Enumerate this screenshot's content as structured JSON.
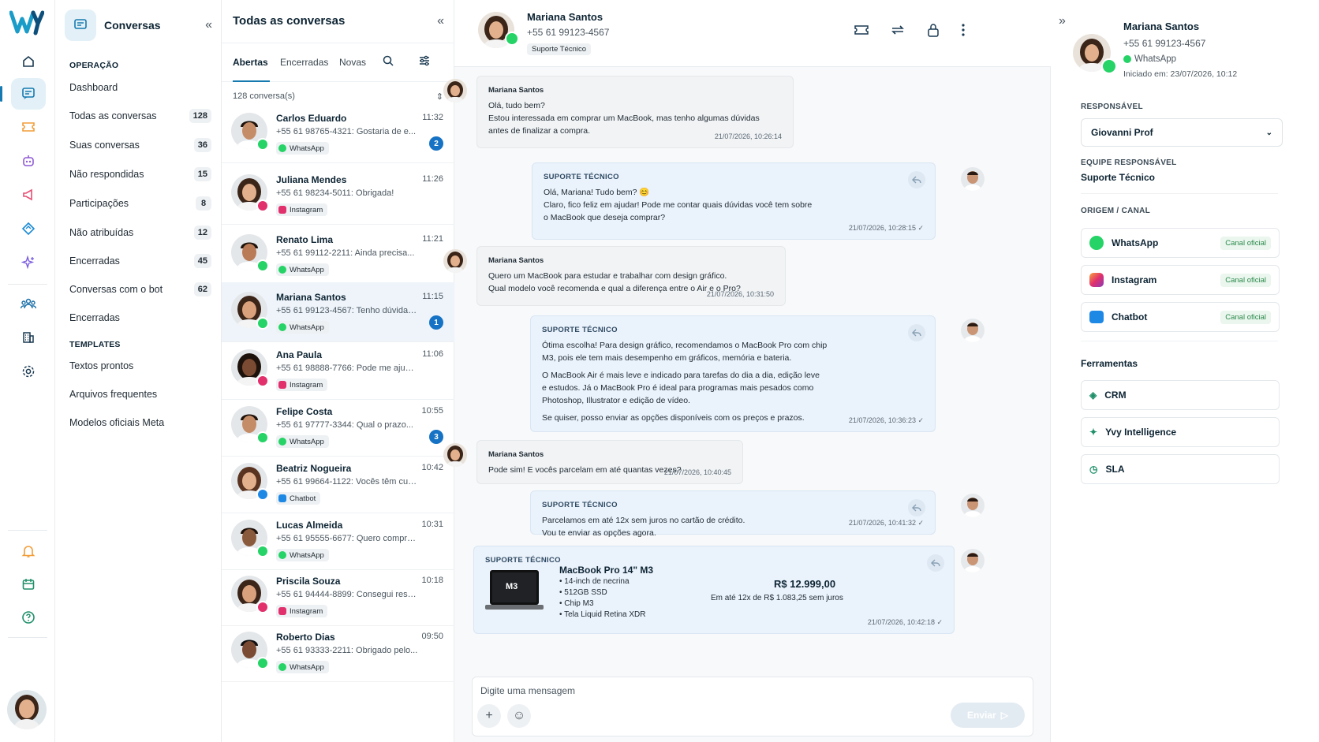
{
  "brand": {
    "logo": "Wy"
  },
  "rail": {
    "items": [
      "home-icon",
      "chat-icon",
      "ticket-icon",
      "bot-icon",
      "megaphone-icon",
      "tag-icon",
      "sparkle-icon",
      "team-icon",
      "building-icon",
      "settings-icon"
    ],
    "bottom": [
      "bell-icon",
      "calendar-icon",
      "help-icon"
    ]
  },
  "nav": {
    "title": "Conversas",
    "section_operacao": "OPERAÇÃO",
    "items": [
      {
        "label": "Dashboard",
        "count": ""
      },
      {
        "label": "Todas as conversas",
        "count": "128"
      },
      {
        "label": "Suas conversas",
        "count": "36"
      },
      {
        "label": "Não respondidas",
        "count": "15"
      },
      {
        "label": "Participações",
        "count": "8"
      },
      {
        "label": "Não atribuídas",
        "count": "12"
      },
      {
        "label": "Encerradas",
        "count": "45"
      },
      {
        "label": "Conversas com o bot",
        "count": "62"
      },
      {
        "label": "Encerradas",
        "count": ""
      }
    ],
    "section_templates": "TEMPLATES",
    "templates": [
      "Textos prontos",
      "Arquivos frequentes",
      "Modelos oficiais Meta"
    ]
  },
  "list": {
    "title": "Todas as conversas",
    "tabs": [
      "Abertas",
      "Encerradas",
      "Novas"
    ],
    "count": "128 conversa(s)",
    "conversations": [
      {
        "name": "Carlos Eduardo",
        "time": "11:32",
        "preview": "+55 61 98765-4321: Gostaria de e...",
        "channel": "WhatsApp",
        "badge": "2"
      },
      {
        "name": "Juliana Mendes",
        "time": "11:26",
        "preview": "+55 61 98234-5011: Obrigada!",
        "channel": "Instagram",
        "badge": ""
      },
      {
        "name": "Renato Lima",
        "time": "11:21",
        "preview": "+55 61 99112-2211: Ainda precisa...",
        "channel": "WhatsApp",
        "badge": ""
      },
      {
        "name": "Mariana Santos",
        "time": "11:15",
        "preview": "+55 61 99123-4567: Tenho dúvidas...",
        "channel": "WhatsApp",
        "badge": "1"
      },
      {
        "name": "Ana Paula",
        "time": "11:06",
        "preview": "+55 61 98888-7766: Pode me ajudar...",
        "channel": "Instagram",
        "badge": ""
      },
      {
        "name": "Felipe Costa",
        "time": "10:55",
        "preview": "+55 61 97777-3344: Qual o prazo...",
        "channel": "WhatsApp",
        "badge": "3"
      },
      {
        "name": "Beatriz Nogueira",
        "time": "10:42",
        "preview": "+55 61 99664-1122: Vocês têm cupom...",
        "channel": "Chatbot",
        "badge": ""
      },
      {
        "name": "Lucas Almeida",
        "time": "10:31",
        "preview": "+55 61 95555-6677: Quero compra...",
        "channel": "WhatsApp",
        "badge": ""
      },
      {
        "name": "Priscila Souza",
        "time": "10:18",
        "preview": "+55 61 94444-8899: Consegui resolver",
        "channel": "Instagram",
        "badge": ""
      },
      {
        "name": "Roberto Dias",
        "time": "09:50",
        "preview": "+55 61 93333-2211: Obrigado pelo...",
        "channel": "WhatsApp",
        "badge": ""
      }
    ]
  },
  "chat": {
    "name": "Mariana Santos",
    "phone": "+55 61 99123-4567",
    "tag": "Suporte Técnico",
    "messages": [
      {
        "from": "Mariana Santos",
        "lines": [
          "Olá, tudo bem?",
          "Estou interessada em comprar um MacBook, mas tenho algumas dúvidas",
          "antes de finalizar a compra."
        ],
        "ts": "21/07/2026, 10:26:14"
      },
      {
        "from": "SUPORTE TÉCNICO",
        "lines": [
          "Olá, Mariana! Tudo bem? 😊",
          "Claro, fico feliz em ajudar! Pode me contar quais dúvidas você tem sobre",
          "o MacBook que deseja comprar?"
        ],
        "ts": "21/07/2026, 10:28:15 ✓"
      },
      {
        "from": "Mariana Santos",
        "lines": [
          "Quero um MacBook para estudar e trabalhar com design gráfico.",
          "Qual modelo você recomenda e qual a diferença entre o Air e o Pro?"
        ],
        "ts": "21/07/2026, 10:31:50"
      },
      {
        "from": "SUPORTE TÉCNICO",
        "lines": [
          "Ótima escolha! Para design gráfico, recomendamos o MacBook Pro com chip",
          "M3, pois ele tem mais desempenho em gráficos, memória e bateria.",
          "",
          "O MacBook Air é mais leve e indicado para tarefas do dia a dia, edição leve",
          "e estudos. Já o MacBook Pro é ideal para programas mais pesados como",
          "Photoshop, Illustrator e edição de vídeo.",
          "",
          "Se quiser, posso enviar as opções disponíveis com os preços e prazos."
        ],
        "ts": "21/07/2026, 10:36:23 ✓"
      },
      {
        "from": "Mariana Santos",
        "lines": [
          "Pode sim! E vocês parcelam em até quantas vezes?"
        ],
        "ts": "21/07/2026, 10:40:45"
      },
      {
        "from": "SUPORTE TÉCNICO",
        "lines": [
          "Parcelamos em até 12x sem juros no cartão de crédito.",
          "Vou te enviar as opções agora."
        ],
        "ts": "21/07/2026, 10:41:32 ✓"
      }
    ],
    "product": {
      "from": "SUPORTE TÉCNICO",
      "title": "MacBook Pro 14\" M3",
      "specs": [
        "• 14-inch de necrina",
        "• 512GB SSD",
        "• Chip M3",
        "• Tela Liquid Retina XDR"
      ],
      "price": "R$ 12.999,00",
      "installments": "Em até 12x de R$ 1.083,25 sem juros",
      "ts": "21/07/2026, 10:42:18 ✓",
      "screen_label": "M3"
    },
    "composer_placeholder": "Digite uma mensagem",
    "send_label": "Enviar"
  },
  "side": {
    "name": "Mariana Santos",
    "phone": "+55 61 99123-4567",
    "channel": "WhatsApp",
    "started": "Iniciado em: 23/07/2026, 10:12",
    "sec_responsavel": "RESPONSÁVEL",
    "responsavel": "Giovanni Prof",
    "sec_equipe": "EQUIPE RESPONSÁVEL",
    "equipe": "Suporte Técnico",
    "sec_origem": "ORIGEM / CANAL",
    "channels": [
      {
        "label": "WhatsApp",
        "badge": "Canal oficial"
      },
      {
        "label": "Instagram",
        "badge": "Canal oficial"
      },
      {
        "label": "Chatbot",
        "badge": "Canal oficial"
      }
    ],
    "tools_title": "Ferramentas",
    "tools": [
      "CRM",
      "Yvy Intelligence",
      "SLA"
    ]
  },
  "colors": {
    "accent": "#167ab0",
    "whatsapp": "#25d366",
    "instagram": "#e1306c",
    "chatbot": "#1e88e5",
    "badge": "#1672c4"
  }
}
